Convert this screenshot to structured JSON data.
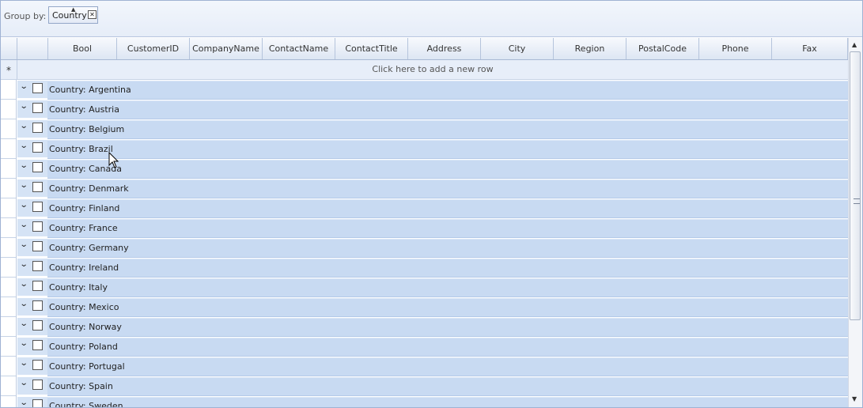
{
  "groupby": {
    "label": "Group by:",
    "chip_label": "Country",
    "chip_close_icon": "close-icon",
    "sort_icon": "sort-ascending-icon"
  },
  "columns": [
    "Bool",
    "CustomerID",
    "CompanyName",
    "ContactName",
    "ContactTitle",
    "Address",
    "City",
    "Region",
    "PostalCode",
    "Phone",
    "Fax"
  ],
  "add_row": {
    "marker": "*",
    "text": "Click here to add a new row"
  },
  "groups": [
    "Country: Argentina",
    "Country: Austria",
    "Country: Belgium",
    "Country: Brazil",
    "Country: Canada",
    "Country: Denmark",
    "Country: Finland",
    "Country: France",
    "Country: Germany",
    "Country: Ireland",
    "Country: Italy",
    "Country: Mexico",
    "Country: Norway",
    "Country: Poland",
    "Country: Portugal",
    "Country: Spain",
    "Country: Sweden"
  ],
  "colors": {
    "group_band": "#c8daf2",
    "header_border": "#b5c4dc",
    "frame_border": "#9fb2d3"
  }
}
